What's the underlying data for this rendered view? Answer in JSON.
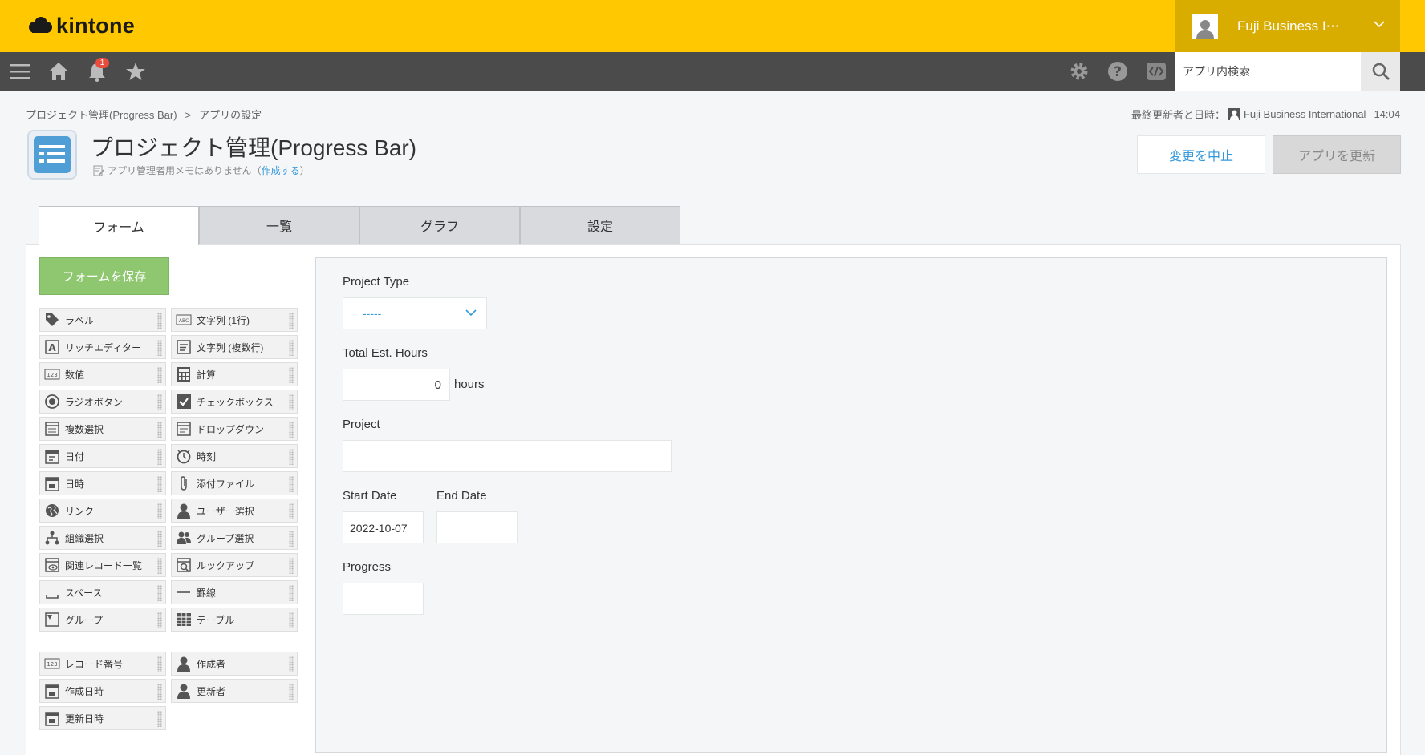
{
  "header": {
    "logo_text": "kintone",
    "user_name": "Fuji Business I⋯"
  },
  "navbar": {
    "notification_count": "1",
    "search_placeholder": "アプリ内検索"
  },
  "breadcrumb": {
    "app": "プロジェクト管理(Progress Bar)",
    "separator": ">",
    "current": "アプリの設定"
  },
  "last_update": {
    "label": "最終更新者と日時：",
    "user": "Fuji Business International",
    "time": "14:04"
  },
  "app": {
    "title": "プロジェクト管理(Progress Bar)",
    "memo_text": "アプリ管理者用メモはありません（",
    "memo_link": "作成する",
    "memo_close": "）"
  },
  "actions": {
    "cancel": "変更を中止",
    "update": "アプリを更新"
  },
  "tabs": [
    "フォーム",
    "一覧",
    "グラフ",
    "設定"
  ],
  "save_form": "フォームを保存",
  "palette": {
    "items": [
      {
        "label": "ラベル",
        "icon": "tag-icon"
      },
      {
        "label": "文字列 (1行)",
        "icon": "text-single-line-icon"
      },
      {
        "label": "リッチエディター",
        "icon": "rich-editor-icon"
      },
      {
        "label": "文字列 (複数行)",
        "icon": "text-multi-line-icon"
      },
      {
        "label": "数値",
        "icon": "number-icon"
      },
      {
        "label": "計算",
        "icon": "calculator-icon"
      },
      {
        "label": "ラジオボタン",
        "icon": "radio-icon"
      },
      {
        "label": "チェックボックス",
        "icon": "checkbox-icon"
      },
      {
        "label": "複数選択",
        "icon": "multi-select-icon"
      },
      {
        "label": "ドロップダウン",
        "icon": "dropdown-icon"
      },
      {
        "label": "日付",
        "icon": "date-icon"
      },
      {
        "label": "時刻",
        "icon": "clock-icon"
      },
      {
        "label": "日時",
        "icon": "datetime-icon"
      },
      {
        "label": "添付ファイル",
        "icon": "paperclip-icon"
      },
      {
        "label": "リンク",
        "icon": "globe-icon"
      },
      {
        "label": "ユーザー選択",
        "icon": "user-icon"
      },
      {
        "label": "組織選択",
        "icon": "organization-icon"
      },
      {
        "label": "グループ選択",
        "icon": "group-icon"
      },
      {
        "label": "関連レコード一覧",
        "icon": "related-records-icon"
      },
      {
        "label": "ルックアップ",
        "icon": "lookup-icon"
      },
      {
        "label": "スペース",
        "icon": "space-icon"
      },
      {
        "label": "罫線",
        "icon": "line-icon"
      },
      {
        "label": "グループ",
        "icon": "group-field-icon"
      },
      {
        "label": "テーブル",
        "icon": "table-icon"
      }
    ],
    "system_items": [
      {
        "label": "レコード番号",
        "icon": "number-icon"
      },
      {
        "label": "作成者",
        "icon": "user-icon"
      },
      {
        "label": "作成日時",
        "icon": "datetime-icon"
      },
      {
        "label": "更新者",
        "icon": "user-icon"
      },
      {
        "label": "更新日時",
        "icon": "datetime-icon"
      }
    ]
  },
  "form": {
    "project_type": {
      "label": "Project Type",
      "value": "-----"
    },
    "total_hours": {
      "label": "Total Est. Hours",
      "value": "0",
      "unit": "hours"
    },
    "project": {
      "label": "Project",
      "value": ""
    },
    "start_date": {
      "label": "Start Date",
      "value": "2022-10-07"
    },
    "end_date": {
      "label": "End Date",
      "value": ""
    },
    "progress": {
      "label": "Progress",
      "value": ""
    }
  }
}
